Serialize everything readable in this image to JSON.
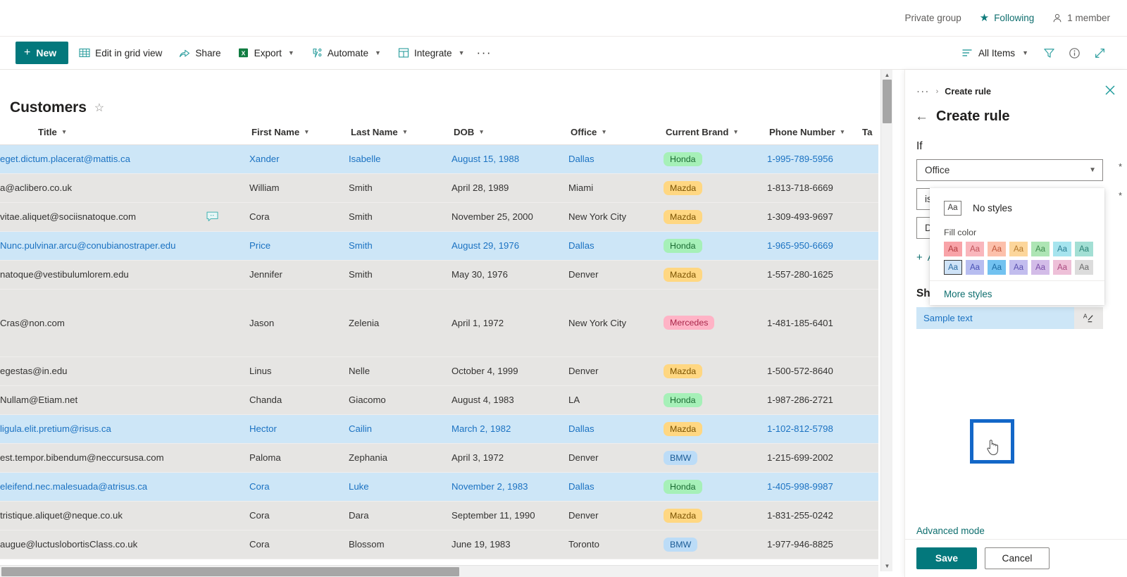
{
  "site_strip": {
    "privacy_label": "Private group",
    "following_label": "Following",
    "members_label": "1 member"
  },
  "command_bar": {
    "new_label": "New",
    "items": [
      {
        "label": "Edit in grid view",
        "icon": "grid-icon",
        "has_chevron": false
      },
      {
        "label": "Share",
        "icon": "share-icon",
        "has_chevron": false
      },
      {
        "label": "Export",
        "icon": "excel-icon",
        "has_chevron": true
      },
      {
        "label": "Automate",
        "icon": "automate-icon",
        "has_chevron": true
      },
      {
        "label": "Integrate",
        "icon": "integrate-icon",
        "has_chevron": true
      }
    ],
    "overflow_label": "···",
    "view_label": "All Items",
    "filter_icon": "filter-icon",
    "info_icon": "info-icon",
    "expand_icon": "expand-icon"
  },
  "list": {
    "title": "Customers",
    "columns": [
      {
        "key": "title",
        "label": "Title"
      },
      {
        "key": "first_name",
        "label": "First Name"
      },
      {
        "key": "last_name",
        "label": "Last Name"
      },
      {
        "key": "dob",
        "label": "DOB"
      },
      {
        "key": "office",
        "label": "Office"
      },
      {
        "key": "brand",
        "label": "Current Brand"
      },
      {
        "key": "phone",
        "label": "Phone Number"
      },
      {
        "key": "ta",
        "label": "Ta"
      }
    ],
    "rows": [
      {
        "title": "eget.dictum.placerat@mattis.ca",
        "first_name": "Xander",
        "last_name": "Isabelle",
        "dob": "August 15, 1988",
        "office": "Dallas",
        "brand": "Honda",
        "brand_color": "#a6f0b8",
        "brand_text": "#1a6b32",
        "phone": "1-995-789-5956",
        "highlight": true,
        "comment": false,
        "tall": false
      },
      {
        "title": "a@aclibero.co.uk",
        "first_name": "William",
        "last_name": "Smith",
        "dob": "April 28, 1989",
        "office": "Miami",
        "brand": "Mazda",
        "brand_color": "#ffd782",
        "brand_text": "#7a5200",
        "phone": "1-813-718-6669",
        "highlight": false,
        "comment": false,
        "tall": false
      },
      {
        "title": "vitae.aliquet@sociisnatoque.com",
        "first_name": "Cora",
        "last_name": "Smith",
        "dob": "November 25, 2000",
        "office": "New York City",
        "brand": "Mazda",
        "brand_color": "#ffd782",
        "brand_text": "#7a5200",
        "phone": "1-309-493-9697",
        "highlight": false,
        "comment": true,
        "tall": false
      },
      {
        "title": "Nunc.pulvinar.arcu@conubianostraper.edu",
        "first_name": "Price",
        "last_name": "Smith",
        "dob": "August 29, 1976",
        "office": "Dallas",
        "brand": "Honda",
        "brand_color": "#a6f0b8",
        "brand_text": "#1a6b32",
        "phone": "1-965-950-6669",
        "highlight": true,
        "comment": false,
        "tall": false
      },
      {
        "title": "natoque@vestibulumlorem.edu",
        "first_name": "Jennifer",
        "last_name": "Smith",
        "dob": "May 30, 1976",
        "office": "Denver",
        "brand": "Mazda",
        "brand_color": "#ffd782",
        "brand_text": "#7a5200",
        "phone": "1-557-280-1625",
        "highlight": false,
        "comment": false,
        "tall": false
      },
      {
        "title": "Cras@non.com",
        "first_name": "Jason",
        "last_name": "Zelenia",
        "dob": "April 1, 1972",
        "office": "New York City",
        "brand": "Mercedes",
        "brand_color": "#ffb3c6",
        "brand_text": "#a8274a",
        "phone": "1-481-185-6401",
        "highlight": false,
        "comment": false,
        "tall": true
      },
      {
        "title": "egestas@in.edu",
        "first_name": "Linus",
        "last_name": "Nelle",
        "dob": "October 4, 1999",
        "office": "Denver",
        "brand": "Mazda",
        "brand_color": "#ffd782",
        "brand_text": "#7a5200",
        "phone": "1-500-572-8640",
        "highlight": false,
        "comment": false,
        "tall": false
      },
      {
        "title": "Nullam@Etiam.net",
        "first_name": "Chanda",
        "last_name": "Giacomo",
        "dob": "August 4, 1983",
        "office": "LA",
        "brand": "Honda",
        "brand_color": "#a6f0b8",
        "brand_text": "#1a6b32",
        "phone": "1-987-286-2721",
        "highlight": false,
        "comment": false,
        "tall": false
      },
      {
        "title": "ligula.elit.pretium@risus.ca",
        "first_name": "Hector",
        "last_name": "Cailin",
        "dob": "March 2, 1982",
        "office": "Dallas",
        "brand": "Mazda",
        "brand_color": "#ffd782",
        "brand_text": "#7a5200",
        "phone": "1-102-812-5798",
        "highlight": true,
        "comment": false,
        "tall": false
      },
      {
        "title": "est.tempor.bibendum@neccursusa.com",
        "first_name": "Paloma",
        "last_name": "Zephania",
        "dob": "April 3, 1972",
        "office": "Denver",
        "brand": "BMW",
        "brand_color": "#bcdcf7",
        "brand_text": "#1b5c96",
        "phone": "1-215-699-2002",
        "highlight": false,
        "comment": false,
        "tall": false
      },
      {
        "title": "eleifend.nec.malesuada@atrisus.ca",
        "first_name": "Cora",
        "last_name": "Luke",
        "dob": "November 2, 1983",
        "office": "Dallas",
        "brand": "Honda",
        "brand_color": "#a6f0b8",
        "brand_text": "#1a6b32",
        "phone": "1-405-998-9987",
        "highlight": true,
        "comment": false,
        "tall": false
      },
      {
        "title": "tristique.aliquet@neque.co.uk",
        "first_name": "Cora",
        "last_name": "Dara",
        "dob": "September 11, 1990",
        "office": "Denver",
        "brand": "Mazda",
        "brand_color": "#ffd782",
        "brand_text": "#7a5200",
        "phone": "1-831-255-0242",
        "highlight": false,
        "comment": false,
        "tall": false
      },
      {
        "title": "augue@luctuslobortisClass.co.uk",
        "first_name": "Cora",
        "last_name": "Blossom",
        "dob": "June 19, 1983",
        "office": "Toronto",
        "brand": "BMW",
        "brand_color": "#bcdcf7",
        "brand_text": "#1b5c96",
        "phone": "1-977-946-8825",
        "highlight": false,
        "comment": false,
        "tall": false
      }
    ]
  },
  "panel": {
    "breadcrumb_dots": "···",
    "breadcrumb_sep": "›",
    "breadcrumb_current": "Create rule",
    "title": "Create rule",
    "if_label": "If",
    "condition_field": "Office",
    "condition_operator": "is equal to",
    "condition_value": "Dallas",
    "required_marker": "*",
    "add_condition_label": "Add condition",
    "add_condition_plus": "+",
    "show_item_label": "Show list item as",
    "sample_text": "Sample text",
    "style_button_icon": "format-painter-icon",
    "advanced_mode_label": "Advanced mode",
    "save_label": "Save",
    "cancel_label": "Cancel",
    "style_picker": {
      "no_styles_label": "No styles",
      "aa_text": "Aa",
      "fill_color_label": "Fill color",
      "more_styles_label": "More styles",
      "row1": [
        {
          "bg": "#f8a3a8",
          "fg": "#b33a3f"
        },
        {
          "bg": "#f9b6bc",
          "fg": "#c1545c"
        },
        {
          "bg": "#fcc0ab",
          "fg": "#c2563a"
        },
        {
          "bg": "#fcd69b",
          "fg": "#b3772a"
        },
        {
          "bg": "#aee5b4",
          "fg": "#3d8a4c"
        },
        {
          "bg": "#a6e4ee",
          "fg": "#2a7e93"
        },
        {
          "bg": "#a3dfd4",
          "fg": "#2c8276"
        }
      ],
      "row2": [
        {
          "bg": "#cfe3f7",
          "fg": "#2b6ca3",
          "selected": true
        },
        {
          "bg": "#b7bdf0",
          "fg": "#4951b5"
        },
        {
          "bg": "#72c2f0",
          "fg": "#1a6ba3"
        },
        {
          "bg": "#c2bdee",
          "fg": "#5a51b0"
        },
        {
          "bg": "#d3bce8",
          "fg": "#7a4da8"
        },
        {
          "bg": "#eec0d8",
          "fg": "#ab4b81"
        },
        {
          "bg": "#dcdcdc",
          "fg": "#6a6a6a"
        }
      ]
    }
  }
}
